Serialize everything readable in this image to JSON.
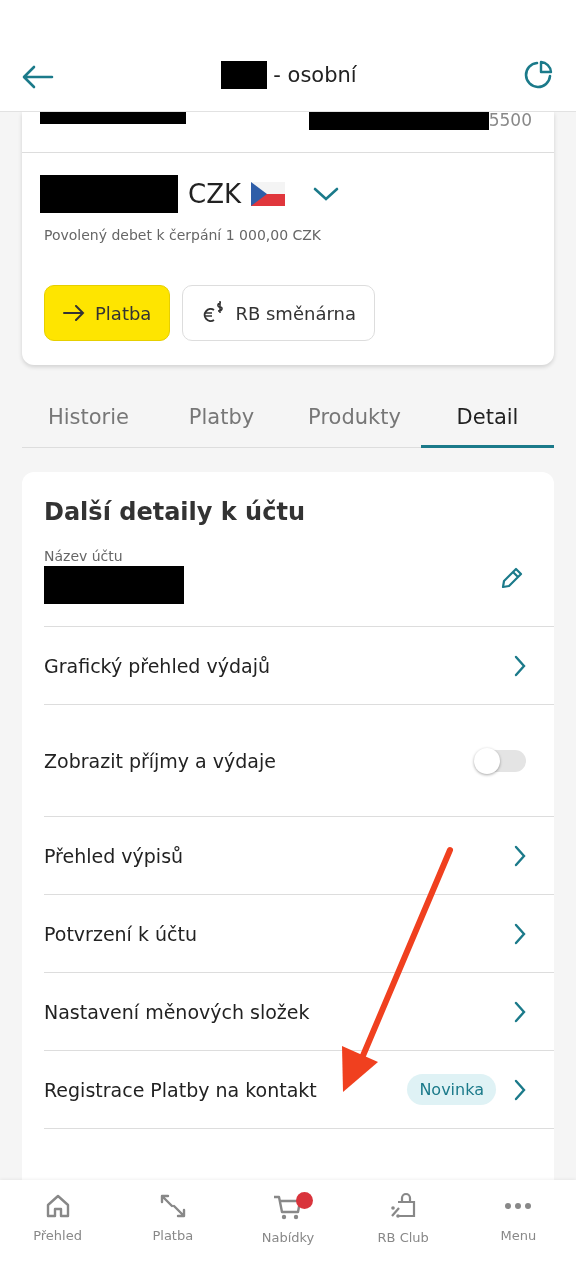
{
  "header": {
    "title": "- osobní"
  },
  "account": {
    "number_suffix": "5500",
    "currency": "CZK",
    "overdraft": "Povolený debet k čerpání 1 000,00 CZK",
    "actions": [
      {
        "kind": "primary",
        "label": "Platba"
      },
      {
        "kind": "secondary",
        "label": "RB směnárna"
      }
    ]
  },
  "tabs": [
    {
      "label": "Historie",
      "selected": false
    },
    {
      "label": "Platby",
      "selected": false
    },
    {
      "label": "Produkty",
      "selected": false
    },
    {
      "label": "Detail",
      "selected": true
    }
  ],
  "details": {
    "title": "Další detaily k účtu",
    "name_label": "Název účtu",
    "rows": [
      {
        "kind": "link",
        "label": "Grafický přehled výdajů"
      },
      {
        "kind": "toggle",
        "label": "Zobrazit příjmy a výdaje",
        "on": false
      },
      {
        "kind": "link",
        "label": "Přehled výpisů"
      },
      {
        "kind": "link",
        "label": "Potvrzení k účtu"
      },
      {
        "kind": "link",
        "label": "Nastavení měnových složek"
      },
      {
        "kind": "link",
        "label": "Registrace Platby na kontakt",
        "badge": "Novinka"
      }
    ]
  },
  "nav": [
    {
      "kind": "home",
      "label": "Přehled",
      "notification": false
    },
    {
      "kind": "transfer",
      "label": "Platba",
      "notification": false
    },
    {
      "kind": "cart",
      "label": "Nabídky",
      "notification": true
    },
    {
      "kind": "bag",
      "label": "RB Club",
      "notification": false
    },
    {
      "kind": "dots",
      "label": "Menu",
      "notification": false
    }
  ]
}
